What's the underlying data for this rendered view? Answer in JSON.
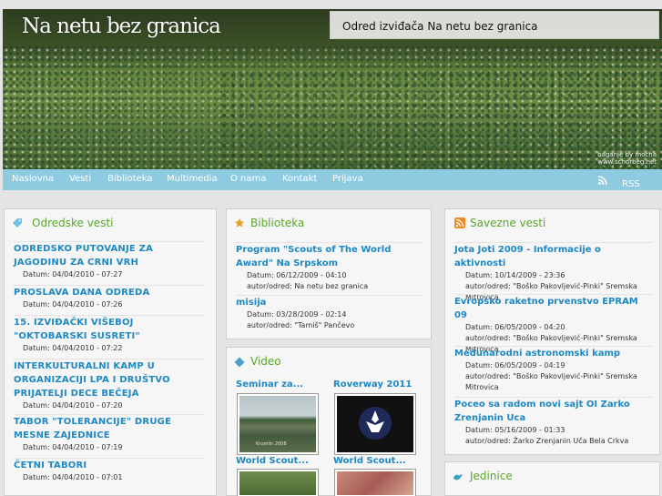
{
  "header": {
    "site_title": "Na netu bez granica",
    "tagline": "Odred izviđača Na netu bez granica",
    "photo_credit_line1": "baganje by mocha",
    "photo_credit_line2": "www.schorbeg.net"
  },
  "nav": {
    "items": [
      "Naslovna",
      "Vesti",
      "Biblioteka",
      "Multimedia",
      "O nama",
      "Kontakt",
      "Prijava"
    ],
    "rss_label": "RSS"
  },
  "odredske": {
    "title": "Odredske vesti",
    "items": [
      {
        "title": "ODREDSKO PUTOVANJE ZA JAGODINU ZA CRNI VRH",
        "meta": "Datum: 04/04/2010 - 07:27"
      },
      {
        "title": "PROSLAVA DANA ODREDA",
        "meta": "Datum: 04/04/2010 - 07:26"
      },
      {
        "title": "15. IZVIĐAČKI VIŠEBOJ \"OKTOBARSKI SUSRETI\"",
        "meta": "Datum: 04/04/2010 - 07:22"
      },
      {
        "title": "INTERKULTURALNI KAMP U ORGANIZACIJI LPA I DRUŠTVO PRIJATELJI DECE BEČEJA",
        "meta": "Datum: 04/04/2010 - 07:20"
      },
      {
        "title": "TABOR \"TOLERANCIJE\" DRUGE MESNE ZAJEDNICE",
        "meta": "Datum: 04/04/2010 - 07:19"
      },
      {
        "title": "ČETNI TABORI",
        "meta": "Datum: 04/04/2010 - 07:01"
      }
    ]
  },
  "biblioteka": {
    "title": "Biblioteka",
    "items": [
      {
        "title": "Program \"Scouts of The World Award\" Na Srpskom",
        "date": "Datum: 06/12/2009 - 04:10",
        "author": "autor/odred: Na netu bez granica"
      },
      {
        "title": "misija",
        "date": "Datum: 03/28/2009 - 02:14",
        "author": "autor/odred: \"Tamiš\" Pančevo"
      }
    ]
  },
  "video": {
    "title": "Video",
    "items": [
      {
        "label": "Seminar za...",
        "caption": "Krumlin 2008"
      },
      {
        "label": "Roverway 2011",
        "caption": ""
      },
      {
        "label": "World Scout...",
        "caption": ""
      },
      {
        "label": "World Scout...",
        "caption": ""
      }
    ]
  },
  "savezne": {
    "title": "Savezne vesti",
    "items": [
      {
        "title": "Jota Joti 2009 - Informacije o aktivnosti",
        "date": "Datum: 10/14/2009 - 23:36",
        "author": "autor/odred: \"Boško Pakovljević-Pinki\" Sremska Mitrovica"
      },
      {
        "title": "Evropsko raketno prvenstvo EPRAM 09",
        "date": "Datum: 06/05/2009 - 04:20",
        "author": "autor/odred: \"Boško Pakovljević-Pinki\" Sremska Mitrovica"
      },
      {
        "title": "Međunarodni astronomski kamp",
        "date": "Datum: 06/05/2009 - 04:19",
        "author": "autor/odred: \"Boško Pakovljević-Pinki\" Sremska Mitrovica"
      },
      {
        "title": "Poceo sa radom novi sajt OI Zarko Zrenjanin Uca",
        "date": "Datum: 05/16/2009 - 01:33",
        "author": "autor/odred: Žarko Zrenjanin Uča Bela Crkva"
      }
    ]
  },
  "jedinice": {
    "title": "Jedinice"
  },
  "colors": {
    "accent_green": "#5aa62a",
    "link_blue": "#1d88c4",
    "nav_blue": "#8fcbe0"
  }
}
